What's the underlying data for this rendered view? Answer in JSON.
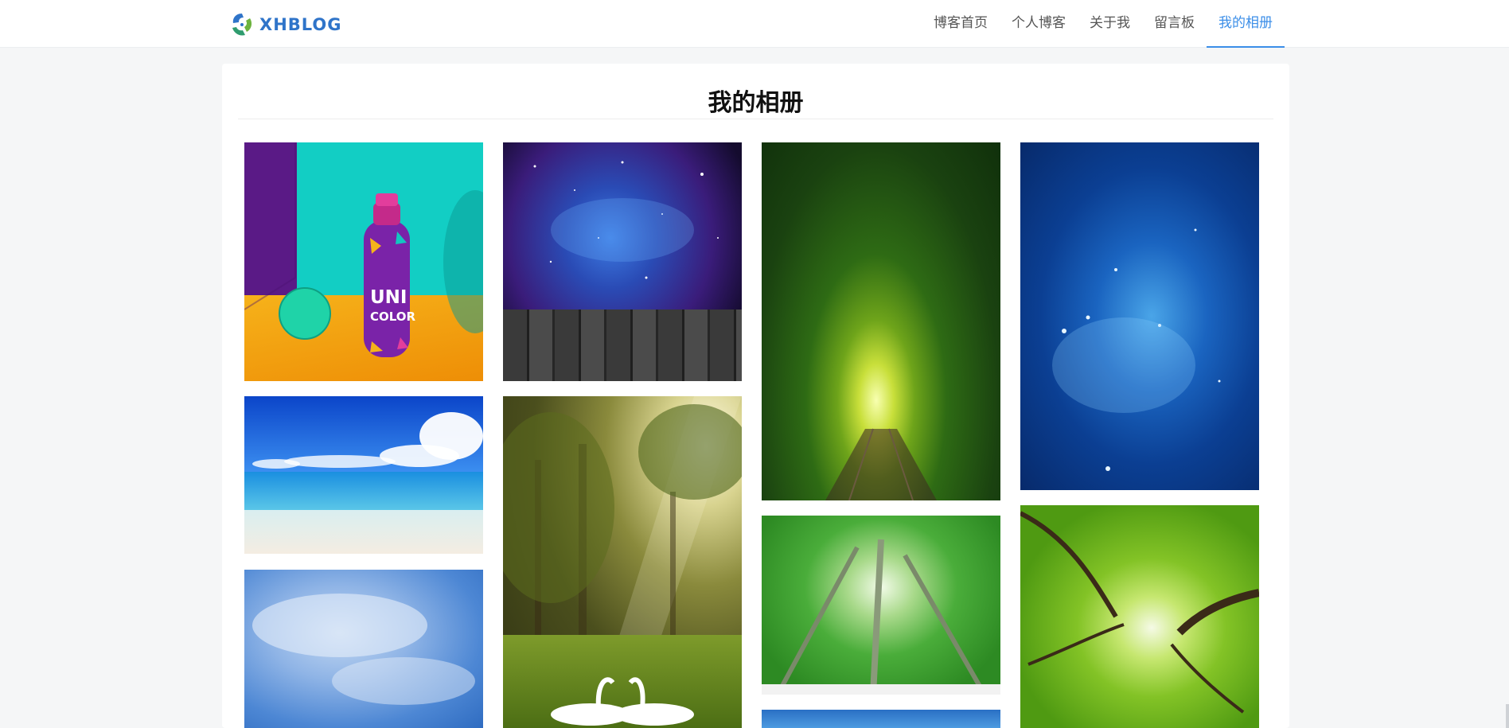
{
  "header": {
    "logo_text": "XHBLOG",
    "nav": [
      {
        "label": "博客首页",
        "active": false
      },
      {
        "label": "个人博客",
        "active": false
      },
      {
        "label": "关于我",
        "active": false
      },
      {
        "label": "留言板",
        "active": false
      },
      {
        "label": "我的相册",
        "active": true
      }
    ]
  },
  "main": {
    "title": "我的相册",
    "photos": [
      {
        "subject": "bottle-still-life",
        "bottle_text_line1": "UNI",
        "bottle_text_line2": "COLOR"
      },
      {
        "subject": "galaxy-over-wood-planks"
      },
      {
        "subject": "green-tree-tunnel"
      },
      {
        "subject": "blue-starfield"
      },
      {
        "subject": "tropical-beach"
      },
      {
        "subject": "sunlit-forest-with-swans"
      },
      {
        "subject": "tree-canopy-looking-up"
      },
      {
        "subject": "blue-cloudy-sky"
      },
      {
        "subject": "green-canopy-looking-up"
      },
      {
        "subject": "partial-lake-view"
      }
    ]
  },
  "colors": {
    "accent": "#3b8ee8",
    "logo": "#2f74c9",
    "page_bg": "#f5f6f7"
  }
}
